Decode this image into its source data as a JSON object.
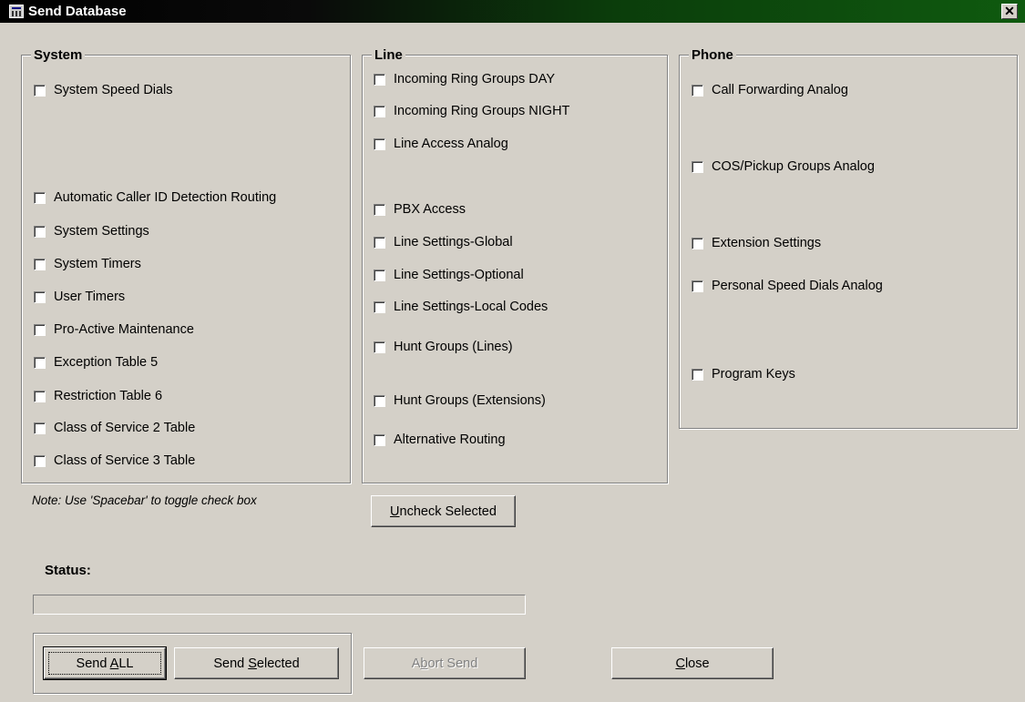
{
  "window": {
    "title": "Send Database",
    "close_label": "✕"
  },
  "groups": {
    "system": {
      "label": "System",
      "items": [
        "System Speed Dials",
        "Automatic Caller ID Detection Routing",
        "System Settings",
        "System Timers",
        "User Timers",
        "Pro-Active Maintenance",
        "Exception Table 5",
        "Restriction Table 6",
        "Class of Service 2 Table",
        "Class of Service 3 Table"
      ]
    },
    "line": {
      "label": "Line",
      "items": [
        "Incoming Ring Groups DAY",
        "Incoming Ring Groups NIGHT",
        "Line Access Analog",
        "PBX Access",
        "Line Settings-Global",
        "Line Settings-Optional",
        "Line Settings-Local Codes",
        "Hunt Groups (Lines)",
        "Hunt Groups (Extensions)",
        "Alternative Routing"
      ]
    },
    "phone": {
      "label": "Phone",
      "items": [
        "Call Forwarding Analog",
        "COS/Pickup Groups Analog",
        "Extension Settings",
        "Personal Speed Dials Analog",
        "Program Keys"
      ]
    }
  },
  "note": "Note: Use 'Spacebar' to toggle check box",
  "buttons": {
    "uncheck": {
      "mnemonic": "U",
      "rest": "ncheck Selected"
    },
    "send_all": {
      "pre": "Send ",
      "mnemonic": "A",
      "rest": "LL"
    },
    "send_selected": {
      "pre": "Send ",
      "mnemonic": "S",
      "rest": "elected"
    },
    "abort": {
      "pre": "A",
      "mnemonic": "b",
      "rest": "ort Send"
    },
    "close": {
      "mnemonic": "C",
      "rest": "lose"
    }
  },
  "status": {
    "label": "Status:",
    "progress": 0
  },
  "icons": {
    "app": "database-send-icon",
    "close": "close-icon"
  }
}
